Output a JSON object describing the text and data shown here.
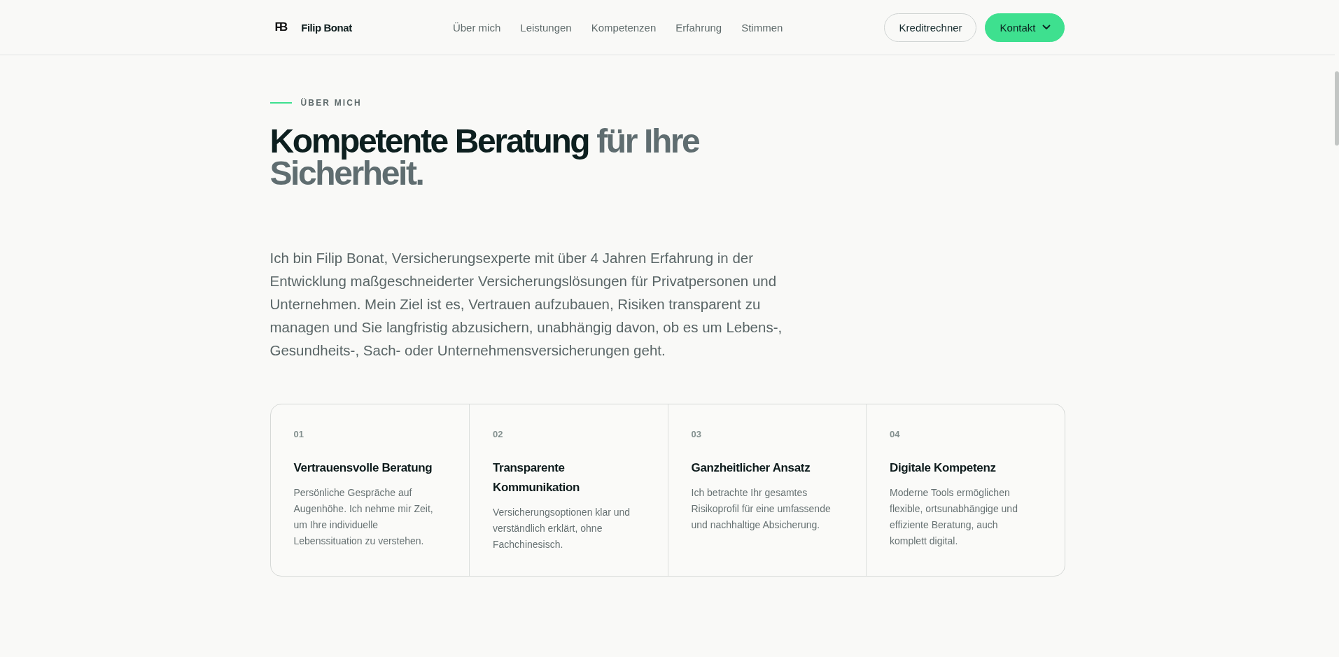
{
  "header": {
    "logo_mark": "FB",
    "brand": "Filip Bonat",
    "nav": [
      "Über mich",
      "Leistungen",
      "Kompetenzen",
      "Erfahrung",
      "Stimmen"
    ],
    "buttons": [
      {
        "label": "Kreditrechner",
        "kind": "outline",
        "has_menu": false
      },
      {
        "label": "Kontakt",
        "kind": "primary",
        "has_menu": true
      }
    ]
  },
  "section": {
    "eyebrow": "ÜBER MICH",
    "title_lead": "Kompetente Beratung",
    "title_rest": "für Ihre Sicherheit.",
    "intro": "Ich bin Filip Bonat, Versicherungsexperte mit über 4 Jahren Erfahrung in der Entwicklung maßgeschneiderter Versicherungslösungen für Privatpersonen und Unternehmen. Mein Ziel ist es, Vertrauen aufzubauen, Risiken transparent zu managen und Sie langfristig abzusichern, unabhängig davon, ob es um Lebens-, Gesundheits-, Sach- oder Unternehmensversicherungen geht.",
    "features": [
      {
        "number": "01",
        "title": "Vertrauensvolle Beratung",
        "text": "Persönliche Gespräche auf Augenhöhe. Ich nehme mir Zeit, um Ihre individuelle Lebenssituation zu verstehen."
      },
      {
        "number": "02",
        "title": "Transparente Kommunikation",
        "text": "Versicherungsoptionen klar und verständlich erklärt, ohne Fachchinesisch."
      },
      {
        "number": "03",
        "title": "Ganzheitlicher Ansatz",
        "text": "Ich betrachte Ihr gesamtes Risikoprofil für eine umfassende und nachhaltige Absicherung."
      },
      {
        "number": "04",
        "title": "Digitale Kompetenz",
        "text": "Moderne Tools ermöglichen flexible, ortsunabhängige und effiziente Beratung, auch komplett digital."
      }
    ]
  }
}
